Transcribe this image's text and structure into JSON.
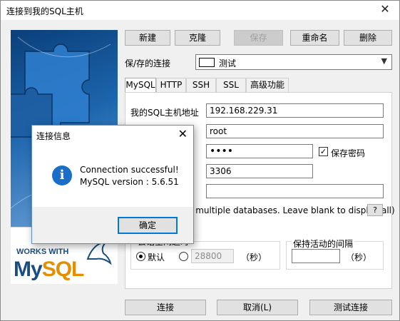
{
  "window": {
    "title": "连接到我的SQL主机",
    "close_glyph": "✕"
  },
  "toolbar": {
    "new_label": "新建",
    "clone_label": "克隆",
    "save_label": "保存",
    "rename_label": "重命名",
    "delete_label": "删除"
  },
  "saved_connection": {
    "label": "保/存的连接",
    "value": "测试"
  },
  "tabs": [
    {
      "label": "MySQL",
      "active": true
    },
    {
      "label": "HTTP",
      "active": false
    },
    {
      "label": "SSH",
      "active": false
    },
    {
      "label": "SSL",
      "active": false
    },
    {
      "label": "高级功能",
      "active": false
    }
  ],
  "form": {
    "host_label": "我的SQL主机地址",
    "host_value": "192.168.229.31",
    "user_value": "root",
    "password_value": "••••",
    "save_password_label": "保存密码",
    "save_password_checked": true,
    "port_value": "3306",
    "database_value": "",
    "db_hint": "e multiple databases. Leave blank to display all)",
    "help_label": "?"
  },
  "session_timeout": {
    "title": "会话空闲超时",
    "default_label": "默认",
    "custom_value": "28800",
    "unit": "（秒）"
  },
  "keepalive": {
    "title": "保持活动的间隔",
    "value": "",
    "unit": "（秒）"
  },
  "bottom": {
    "connect_label": "连接",
    "cancel_label": "取消(L)",
    "test_label": "测试连接"
  },
  "logo": {
    "works_with": "WORKS WITH",
    "my": "My",
    "sql": "SQL"
  },
  "dialog": {
    "title": "连接信息",
    "close_glyph": "✕",
    "icon_glyph": "i",
    "line1": "Connection successful!",
    "line2": "MySQL version : 5.6.51",
    "ok_label": "确定"
  }
}
